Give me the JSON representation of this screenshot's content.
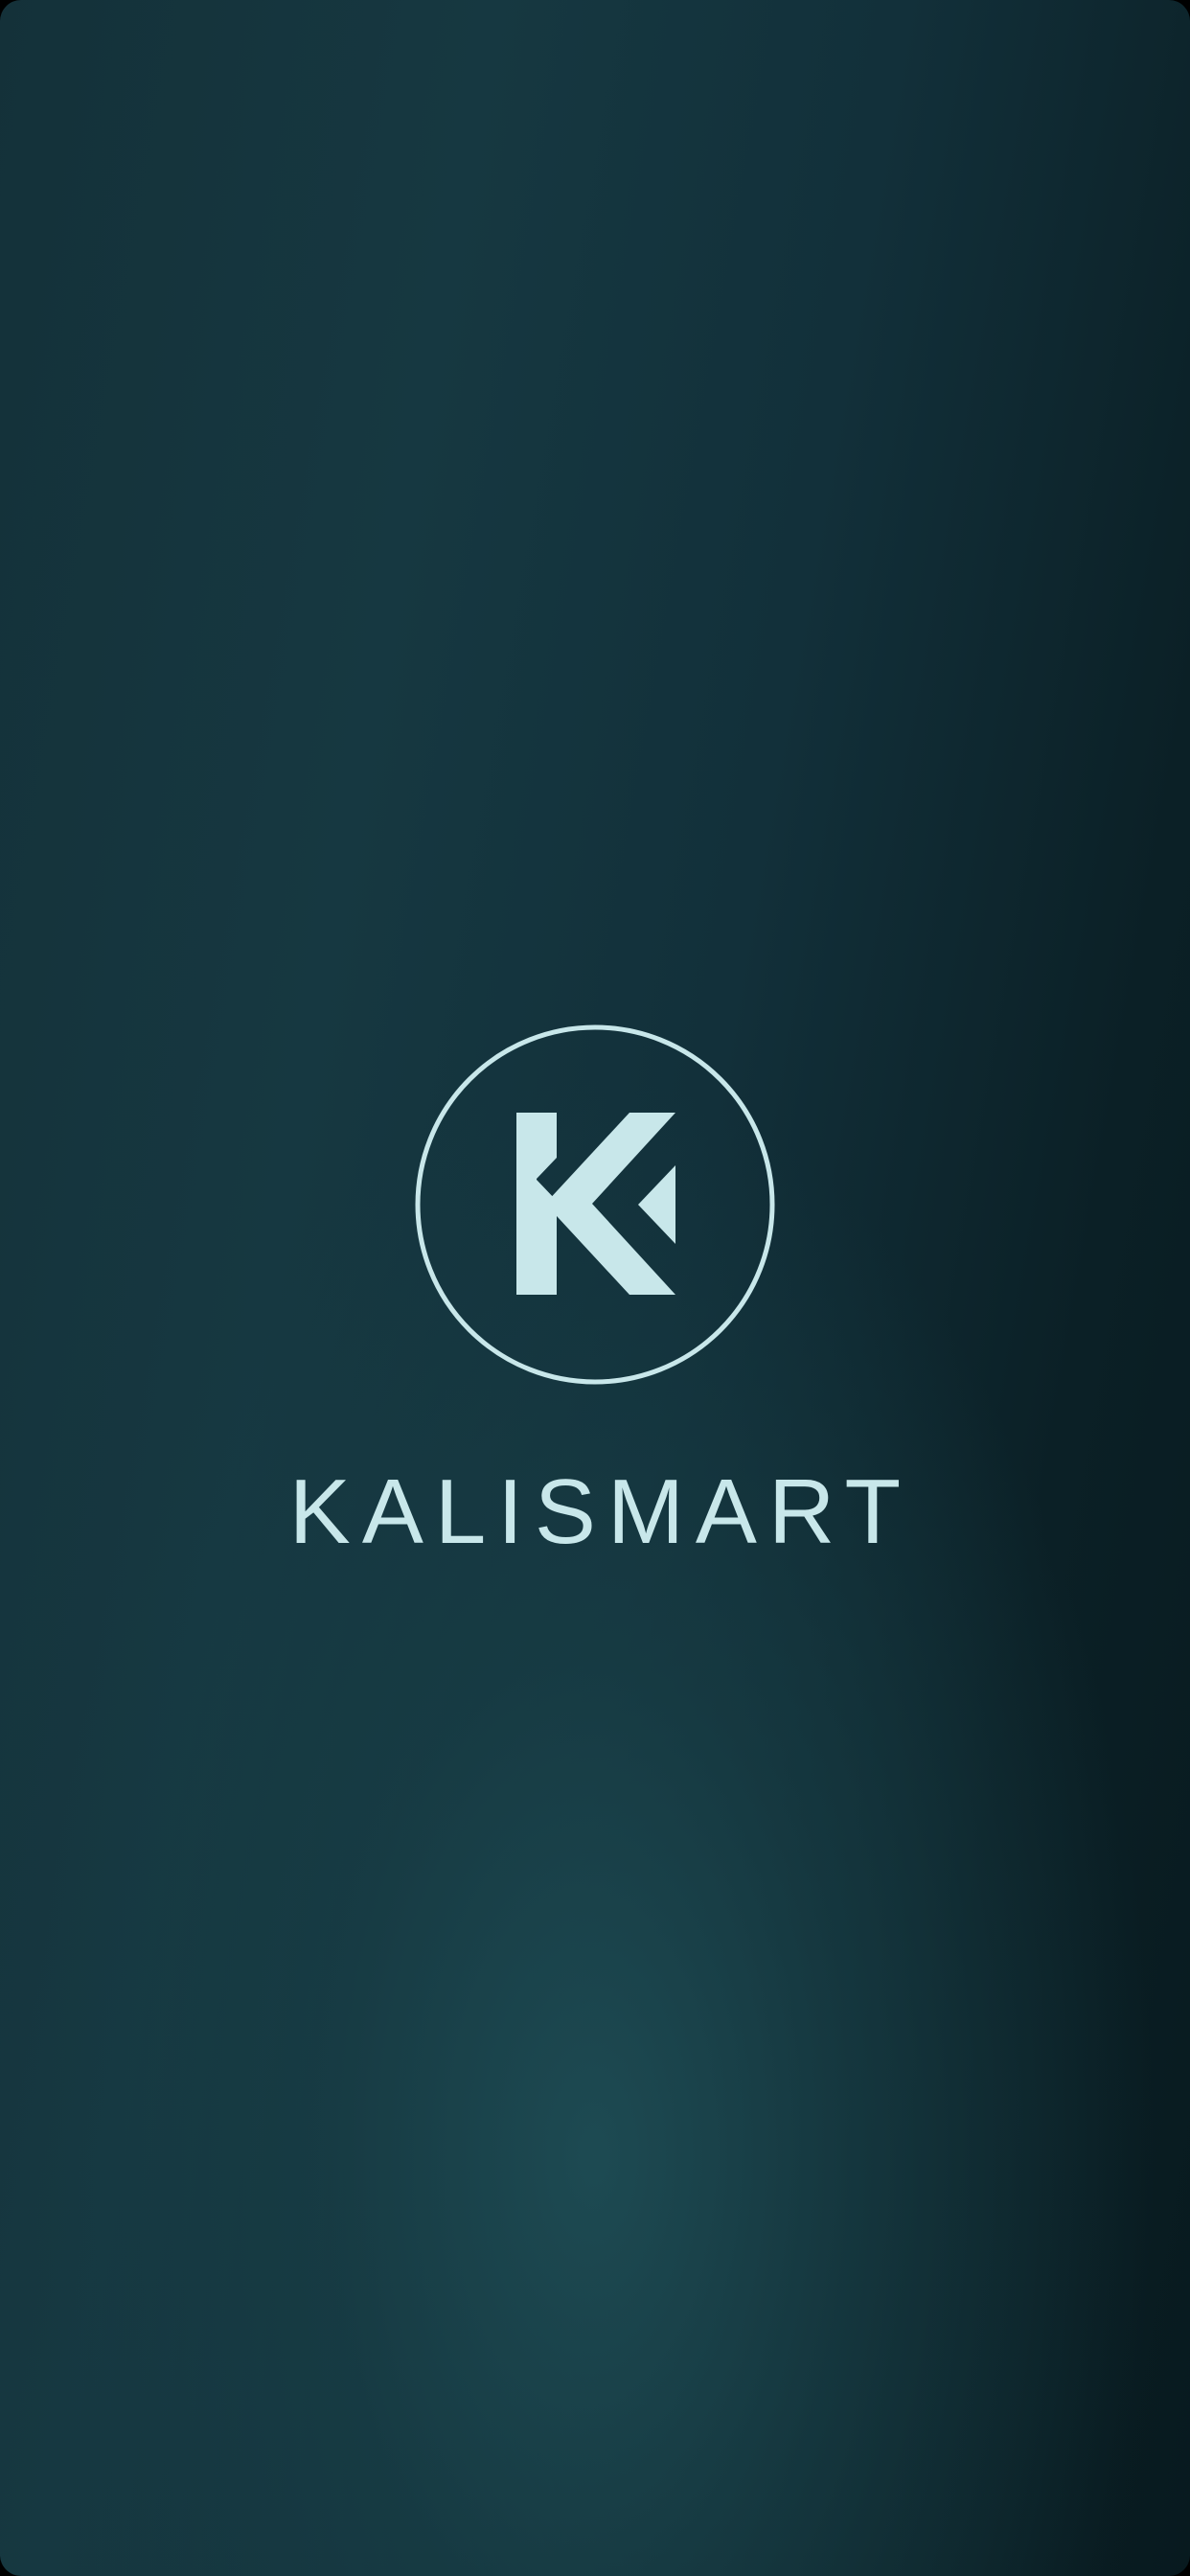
{
  "app": {
    "brand_name": "KALISMART"
  },
  "logo": {
    "icon": "k-chevron-logo-icon",
    "color": "#c8e7ea"
  },
  "colors": {
    "background_dark": "#081a1f",
    "background_mid": "#163841",
    "glow": "#1e4c54",
    "accent": "#c8e7ea"
  }
}
